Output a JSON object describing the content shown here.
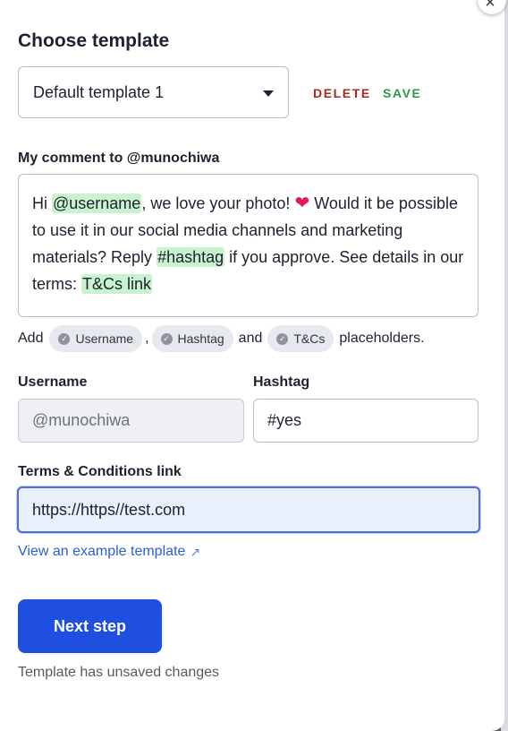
{
  "modal": {
    "title": "Choose template",
    "close_glyph": "×"
  },
  "template_select": {
    "value": "Default template 1",
    "delete_label": "DELETE",
    "save_label": "SAVE"
  },
  "comment": {
    "label": "My comment to @munochiwa",
    "segments": {
      "t1": "Hi ",
      "username": "@username",
      "t2": ", we love your photo! ",
      "heart": "❤",
      "t3": " Would it be possible to use it in our social media channels and marketing materials? Reply ",
      "hashtag": "#hashtag",
      "t4": " if you approve. See details in our terms: ",
      "tcs": "T&Cs link"
    }
  },
  "placeholders": {
    "prefix": "Add",
    "chips": [
      "Username",
      "Hashtag",
      "T&Cs"
    ],
    "sep1": ",",
    "sep2": "and",
    "suffix": "placeholders."
  },
  "fields": {
    "username_label": "Username",
    "username_value": "@munochiwa",
    "hashtag_label": "Hashtag",
    "hashtag_value": "#yes",
    "terms_label": "Terms & Conditions link",
    "terms_value": "https://https//test.com"
  },
  "example_link": "View an example template",
  "next_button": "Next step",
  "status_text": "Template has unsaved changes",
  "colors": {
    "primary": "#1f4fe0",
    "delete": "#b3261e",
    "save": "#2e9a4e",
    "highlight": "#c9f2cf",
    "link": "#2c5fd6"
  }
}
